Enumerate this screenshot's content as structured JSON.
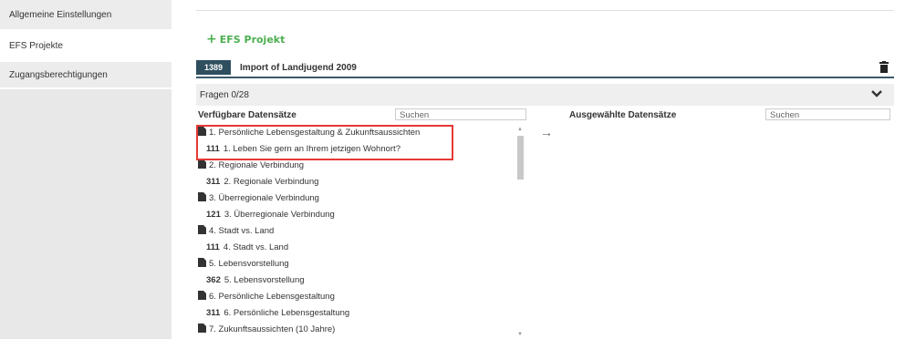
{
  "sidebar": {
    "items": [
      {
        "label": "Allgemeine Einstellungen"
      },
      {
        "label": "EFS Projekte"
      },
      {
        "label": "Zugangsberechtigungen"
      }
    ]
  },
  "toolbar": {
    "add_project_label": "EFS Projekt"
  },
  "project": {
    "id": "1389",
    "name": "Import of Landjugend 2009"
  },
  "fragen": {
    "label": "Fragen 0/28"
  },
  "available": {
    "header": "Verfügbare Datensätze",
    "search_value": "Suchen",
    "rows": [
      {
        "type": "category",
        "label": "1. Persönliche Lebensgestaltung & Zukunftsaussichten"
      },
      {
        "type": "question",
        "id": "111",
        "label": "1. Leben Sie gern an Ihrem jetzigen Wohnort?"
      },
      {
        "type": "category",
        "label": "2. Regionale Verbindung"
      },
      {
        "type": "question",
        "id": "311",
        "label": "2. Regionale Verbindung"
      },
      {
        "type": "category",
        "label": "3. Überregionale Verbindung"
      },
      {
        "type": "question",
        "id": "121",
        "label": "3. Überregionale Verbindung"
      },
      {
        "type": "category",
        "label": "4. Stadt vs. Land"
      },
      {
        "type": "question",
        "id": "111",
        "label": "4. Stadt vs. Land"
      },
      {
        "type": "category",
        "label": "5. Lebensvorstellung"
      },
      {
        "type": "question",
        "id": "362",
        "label": "5. Lebensvorstellung"
      },
      {
        "type": "category",
        "label": "6. Persönliche Lebensgestaltung"
      },
      {
        "type": "question",
        "id": "311",
        "label": "6. Persönliche Lebensgestaltung"
      },
      {
        "type": "category",
        "label": "7. Zukunftsaussichten (10 Jahre)"
      }
    ]
  },
  "selected": {
    "header": "Ausgewählte Datensätze",
    "search_value": "Suchen"
  },
  "icons": {
    "add": "plus-icon",
    "trash": "trash-icon",
    "collapse": "chevron-down-icon",
    "move": "arrow-right-icon",
    "category": "document-icon"
  },
  "colors": {
    "accent_green": "#4caf50",
    "project_badge": "#2f4f5f",
    "highlight_red": "#e53935"
  }
}
